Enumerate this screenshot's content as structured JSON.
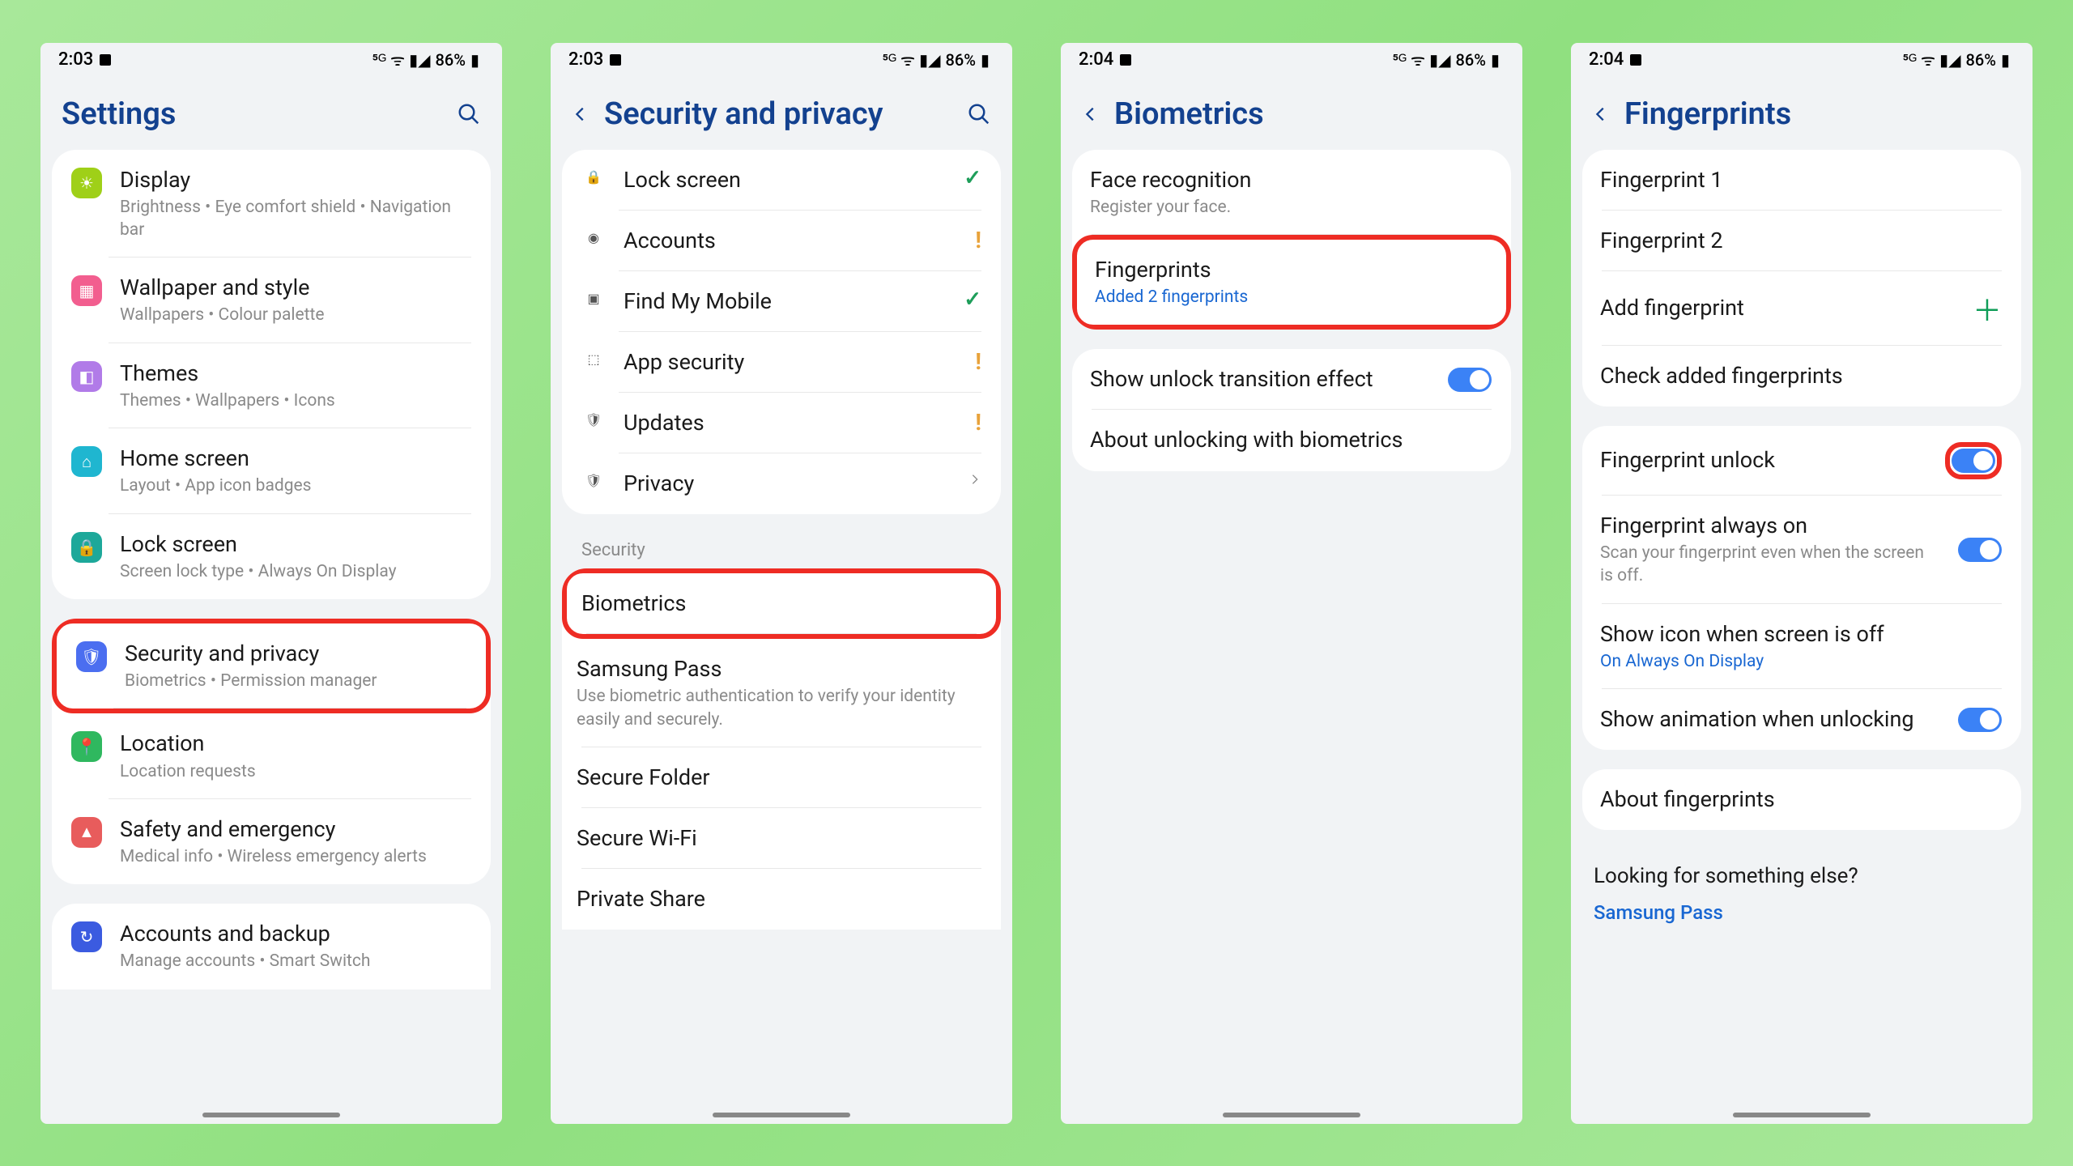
{
  "status": {
    "time1": "2:03",
    "time2": "2:04",
    "battery": "86%"
  },
  "screen1": {
    "title": "Settings",
    "group1": [
      {
        "label": "Display",
        "sub": "Brightness  •  Eye comfort shield  •  Navigation bar",
        "color": "#9fd018"
      },
      {
        "label": "Wallpaper and style",
        "sub": "Wallpapers  •  Colour palette",
        "color": "#f25e8f"
      },
      {
        "label": "Themes",
        "sub": "Themes  •  Wallpapers  •  Icons",
        "color": "#b17be8"
      },
      {
        "label": "Home screen",
        "sub": "Layout  •  App icon badges",
        "color": "#1fb6d0"
      },
      {
        "label": "Lock screen",
        "sub": "Screen lock type  •  Always On Display",
        "color": "#1da89a"
      }
    ],
    "group2": [
      {
        "label": "Security and privacy",
        "sub": "Biometrics  •  Permission manager",
        "color": "#4b6ef0",
        "highlight": true
      },
      {
        "label": "Location",
        "sub": "Location requests",
        "color": "#2fb85f"
      },
      {
        "label": "Safety and emergency",
        "sub": "Medical info  •  Wireless emergency alerts",
        "color": "#e85c5c"
      }
    ],
    "group3": [
      {
        "label": "Accounts and backup",
        "sub": "Manage accounts  •  Smart Switch",
        "color": "#3b5be0"
      }
    ]
  },
  "screen2": {
    "title": "Security and privacy",
    "items": [
      {
        "label": "Lock screen",
        "status": "check"
      },
      {
        "label": "Accounts",
        "status": "alert"
      },
      {
        "label": "Find My Mobile",
        "status": "check"
      },
      {
        "label": "App security",
        "status": "alert"
      },
      {
        "label": "Updates",
        "status": "alert"
      },
      {
        "label": "Privacy",
        "status": "chevron"
      }
    ],
    "section": "Security",
    "sec_items": [
      {
        "label": "Biometrics",
        "highlight": true
      },
      {
        "label": "Samsung Pass",
        "sub": "Use biometric authentication to verify your identity easily and securely."
      },
      {
        "label": "Secure Folder"
      },
      {
        "label": "Secure Wi-Fi"
      },
      {
        "label": "Private Share"
      }
    ]
  },
  "screen3": {
    "title": "Biometrics",
    "group1": [
      {
        "label": "Face recognition",
        "sub": "Register your face."
      },
      {
        "label": "Fingerprints",
        "sub": "Added 2 fingerprints",
        "sub_blue": true,
        "highlight": true
      }
    ],
    "group2": [
      {
        "label": "Show unlock transition effect",
        "toggle": true
      },
      {
        "label": "About unlocking with biometrics"
      }
    ]
  },
  "screen4": {
    "title": "Fingerprints",
    "group1": [
      {
        "label": "Fingerprint 1"
      },
      {
        "label": "Fingerprint 2"
      },
      {
        "label": "Add fingerprint",
        "plus": true
      },
      {
        "label": "Check added fingerprints"
      }
    ],
    "group2": [
      {
        "label": "Fingerprint unlock",
        "toggle": true,
        "toggle_highlight": true
      },
      {
        "label": "Fingerprint always on",
        "sub": "Scan your fingerprint even when the screen is off.",
        "toggle": true
      },
      {
        "label": "Show icon when screen is off",
        "sub": "On Always On Display",
        "sub_blue": true
      },
      {
        "label": "Show animation when unlocking",
        "toggle": true
      }
    ],
    "group3": [
      {
        "label": "About fingerprints"
      }
    ],
    "looking": {
      "q": "Looking for something else?",
      "link": "Samsung Pass"
    }
  }
}
